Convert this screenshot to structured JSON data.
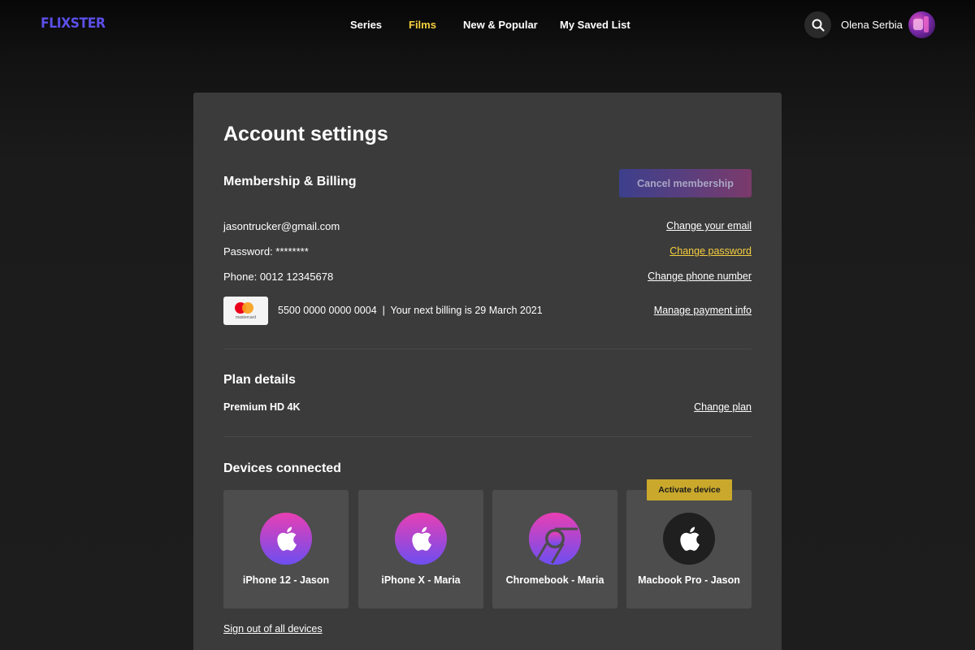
{
  "app": {
    "logo": "FLIXSTER"
  },
  "nav": {
    "items": [
      {
        "label": "Series"
      },
      {
        "label": "Films",
        "active": true
      },
      {
        "label": "New & Popular"
      },
      {
        "label": "My Saved List"
      }
    ],
    "search_icon": "search-icon",
    "username": "Olena Serbia"
  },
  "colors": {
    "accent_yellow": "#f5cf3e",
    "logo_purple": "#5b4fe8",
    "card_bg": "#3b3b3b",
    "device_bg": "#4d4d4d",
    "activate_badge": "#c9a82c"
  },
  "account": {
    "title": "Account settings",
    "membership": {
      "title": "Membership & Billing",
      "cancel_label": "Cancel membership",
      "email": "jasontrucker@gmail.com",
      "email_link": "Change your email",
      "password": "Password: ********",
      "password_link": "Change password",
      "phone": "Phone: 0012 12345678",
      "phone_link": "Change phone number",
      "card_brand": "mastercard",
      "billing_info": "5500 0000 0000 0004  |  Your next billing is 29 March 2021",
      "payment_link": "Manage payment info"
    },
    "plan": {
      "title": "Plan details",
      "name": "Premium HD 4K",
      "change_link": "Change plan"
    },
    "devices": {
      "title": "Devices connected",
      "items": [
        {
          "name": "iPhone 12 - Jason",
          "icon": "apple-icon"
        },
        {
          "name": "iPhone X - Maria",
          "icon": "apple-icon"
        },
        {
          "name": "Chromebook - Maria",
          "icon": "chrome-icon"
        },
        {
          "name": "Macbook Pro - Jason",
          "icon": "apple-icon",
          "inactive": true
        }
      ],
      "activate_label": "Activate device",
      "signout_link": "Sign out of all devices"
    }
  }
}
